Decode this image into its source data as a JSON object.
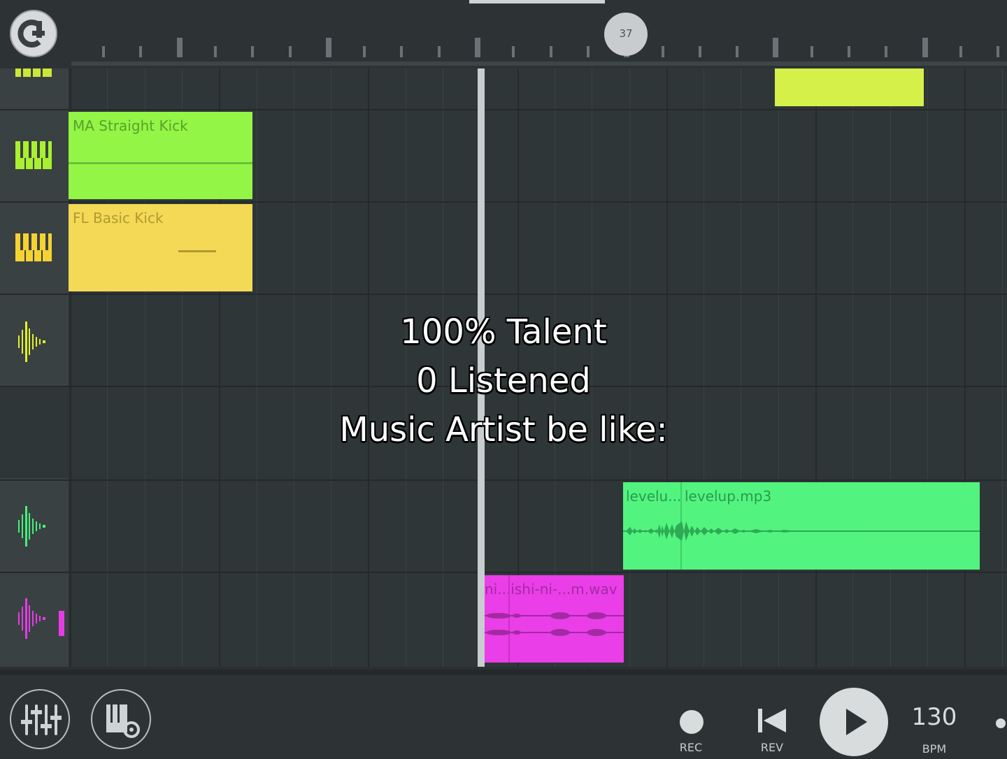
{
  "timeline": {
    "position_badge": "37"
  },
  "tracks": [
    {
      "icon": "piano-roll-icon",
      "color": "#cde63a"
    },
    {
      "icon": "piano-roll-icon",
      "color": "#a8f030"
    },
    {
      "icon": "piano-roll-icon",
      "color": "#f5d232"
    },
    {
      "icon": "waveform-icon",
      "color": "#e3f02c"
    },
    {
      "icon": "",
      "color": ""
    },
    {
      "icon": "waveform-icon",
      "color": "#45f07a"
    },
    {
      "icon": "waveform-icon",
      "color": "#e63ce6"
    }
  ],
  "clips": {
    "ma_straight_kick": {
      "label": "MA Straight Kick",
      "color": "#93f545"
    },
    "fl_basic_kick": {
      "label": "FL Basic Kick",
      "color": "#f3d955"
    },
    "top_pattern": {
      "label": "",
      "color": "#d6f04a"
    },
    "levelup_a": {
      "label": "levelu...",
      "color": "#52f47f"
    },
    "levelup_b": {
      "label": "levelup.mp3",
      "color": "#52f47f"
    },
    "ishi_wav": {
      "label": "ni...ishi-ni-...m.wav",
      "color": "#ea3ee8"
    }
  },
  "overlay": {
    "line1": "100% Talent",
    "line2": "0 Listened",
    "line3": "Music Artist be like:"
  },
  "controls": {
    "rec_label": "REC",
    "rev_label": "REV",
    "bpm_value": "130",
    "bpm_label": "BPM"
  }
}
